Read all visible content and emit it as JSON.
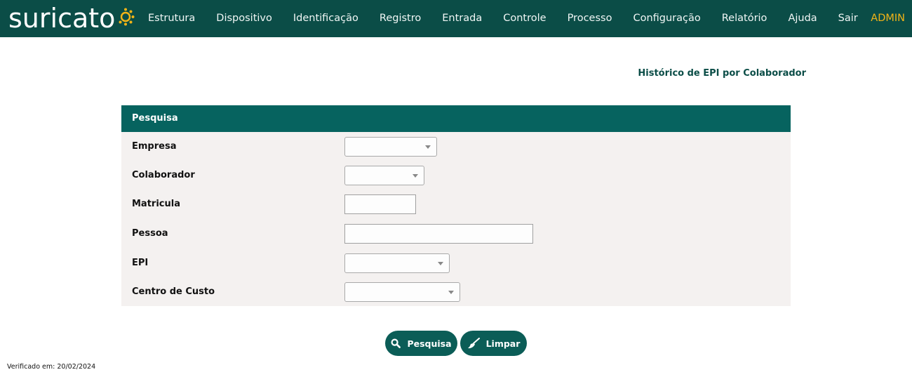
{
  "brand": {
    "name": "suricato"
  },
  "nav": {
    "items": [
      {
        "label": "Estrutura"
      },
      {
        "label": "Dispositivo"
      },
      {
        "label": "Identificação"
      },
      {
        "label": "Registro"
      },
      {
        "label": "Entrada"
      },
      {
        "label": "Controle"
      },
      {
        "label": "Processo"
      },
      {
        "label": "Configuração"
      },
      {
        "label": "Relatório"
      },
      {
        "label": "Ajuda"
      },
      {
        "label": "Sair"
      }
    ],
    "user": "ADMIN"
  },
  "page": {
    "title": "Histórico de EPI por Colaborador"
  },
  "search": {
    "header": "Pesquisa",
    "fields": {
      "empresa": {
        "label": "Empresa",
        "value": ""
      },
      "colaborador": {
        "label": "Colaborador",
        "value": ""
      },
      "matricula": {
        "label": "Matricula",
        "value": ""
      },
      "pessoa": {
        "label": "Pessoa",
        "value": ""
      },
      "epi": {
        "label": "EPI",
        "value": ""
      },
      "centro_custo": {
        "label": "Centro de Custo",
        "value": ""
      }
    }
  },
  "actions": {
    "search_label": "Pesquisa",
    "clear_label": "Limpar"
  },
  "footer": {
    "verified": "Verificado em: 20/02/2024"
  },
  "colors": {
    "header": "#0b4d47",
    "panel_header": "#06635f",
    "accent": "#f2b417",
    "button": "#0b5d57"
  }
}
